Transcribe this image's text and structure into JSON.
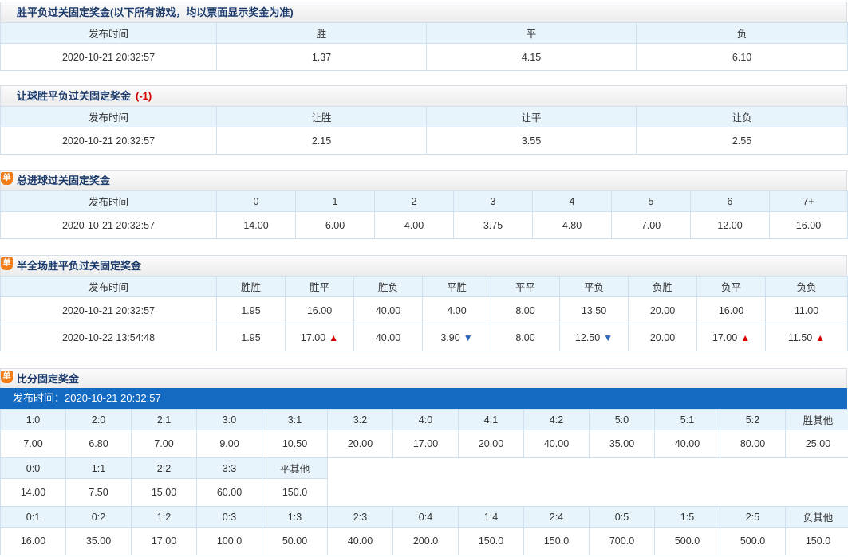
{
  "sec1": {
    "title": "胜平负过关固定奖金(以下所有游戏，均以票面显示奖金为准)",
    "headers": [
      "发布时间",
      "胜",
      "平",
      "负"
    ],
    "rows": [
      [
        "2020-10-21 20:32:57",
        "1.37",
        "4.15",
        "6.10"
      ]
    ]
  },
  "sec2": {
    "title": "让球胜平负过关固定奖金",
    "handicap": "(-1)",
    "headers": [
      "发布时间",
      "让胜",
      "让平",
      "让负"
    ],
    "rows": [
      [
        "2020-10-21 20:32:57",
        "2.15",
        "3.55",
        "2.55"
      ]
    ]
  },
  "sec3": {
    "badge": "单",
    "title": "总进球过关固定奖金",
    "headers": [
      "发布时间",
      "0",
      "1",
      "2",
      "3",
      "4",
      "5",
      "6",
      "7+"
    ],
    "rows": [
      [
        "2020-10-21 20:32:57",
        "14.00",
        "6.00",
        "4.00",
        "3.75",
        "4.80",
        "7.00",
        "12.00",
        "16.00"
      ]
    ]
  },
  "sec4": {
    "badge": "单",
    "title": "半全场胜平负过关固定奖金",
    "headers": [
      "发布时间",
      "胜胜",
      "胜平",
      "胜负",
      "平胜",
      "平平",
      "平负",
      "负胜",
      "负平",
      "负负"
    ],
    "rows": [
      [
        "2020-10-21 20:32:57",
        "1.95",
        "16.00",
        "40.00",
        "4.00",
        "8.00",
        "13.50",
        "20.00",
        "16.00",
        "11.00"
      ],
      [
        "2020-10-22 13:54:48",
        "1.95",
        "17.00",
        "40.00",
        "3.90",
        "8.00",
        "12.50",
        "20.00",
        "17.00",
        "11.50"
      ]
    ],
    "row2_trends": [
      "",
      "",
      "up",
      "",
      "down",
      "",
      "down",
      "",
      "up",
      "up"
    ]
  },
  "sec5": {
    "badge": "单",
    "title": "比分固定奖金",
    "publish_label": "发布时间：2020-10-21 20:32:57",
    "win_headers": [
      "1:0",
      "2:0",
      "2:1",
      "3:0",
      "3:1",
      "3:2",
      "4:0",
      "4:1",
      "4:2",
      "5:0",
      "5:1",
      "5:2",
      "胜其他"
    ],
    "win_values": [
      "7.00",
      "6.80",
      "7.00",
      "9.00",
      "10.50",
      "20.00",
      "17.00",
      "20.00",
      "40.00",
      "35.00",
      "40.00",
      "80.00",
      "25.00"
    ],
    "draw_headers": [
      "0:0",
      "1:1",
      "2:2",
      "3:3",
      "平其他"
    ],
    "draw_values": [
      "14.00",
      "7.50",
      "15.00",
      "60.00",
      "150.0"
    ],
    "loss_headers": [
      "0:1",
      "0:2",
      "1:2",
      "0:3",
      "1:3",
      "2:3",
      "0:4",
      "1:4",
      "2:4",
      "0:5",
      "1:5",
      "2:5",
      "负其他"
    ],
    "loss_values": [
      "16.00",
      "35.00",
      "17.00",
      "100.0",
      "50.00",
      "40.00",
      "200.0",
      "150.0",
      "150.0",
      "700.0",
      "500.0",
      "500.0",
      "150.0"
    ]
  },
  "colors": {
    "up_arrow": "#d40000",
    "down_arrow": "#2a63b8",
    "header_bg": "#e8f4fc",
    "blue_bar": "#1469c0",
    "badge": "#f07d1a"
  },
  "icons": {
    "up": "▲",
    "down": "▼"
  }
}
